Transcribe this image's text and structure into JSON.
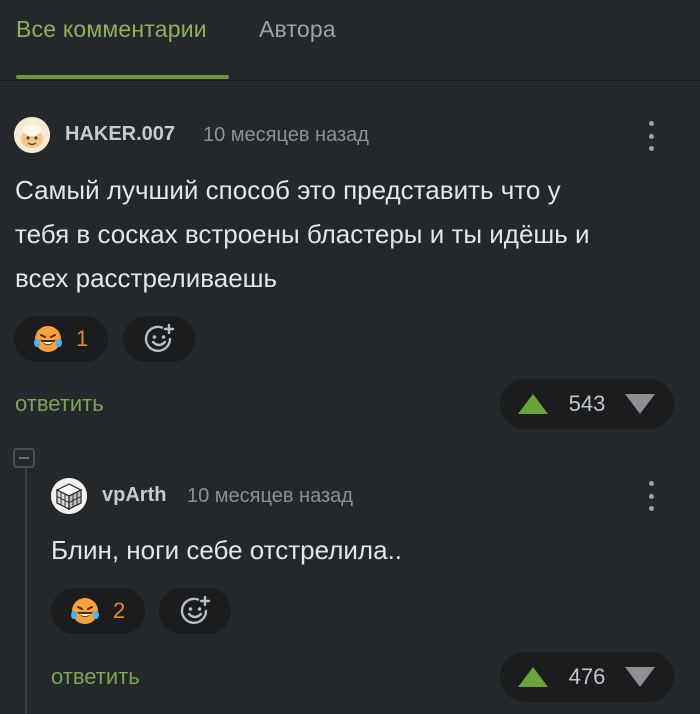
{
  "tabs": [
    {
      "label": "Все комментарии",
      "active": true
    },
    {
      "label": "Автора",
      "active": false
    }
  ],
  "comments": [
    {
      "author": "HAKER.007",
      "time": "10 месяцев назад",
      "avatar_icon": "cartoon-avatar-icon",
      "text_lines": [
        "Самый лучший способ это представить что у",
        "тебя в сосках встроены бластеры и ты идёшь и",
        "всех расстреливаешь"
      ],
      "reaction": {
        "icon": "laughing-tears-emoji-icon",
        "count": "1"
      },
      "reply_label": "ответить",
      "votes": "543"
    },
    {
      "author": "vpArth",
      "time": "10 месяцев назад",
      "avatar_icon": "cube-avatar-icon",
      "text_lines": [
        "Блин, ноги себе отстрелила.."
      ],
      "reaction": {
        "icon": "laughing-tears-emoji-icon",
        "count": "2"
      },
      "reply_label": "ответить",
      "votes": "476"
    }
  ],
  "colors": {
    "background": "#25282b",
    "accent_green": "#8fb15c",
    "vote_green": "#6aa43a",
    "reaction_orange": "#e08c3a"
  }
}
